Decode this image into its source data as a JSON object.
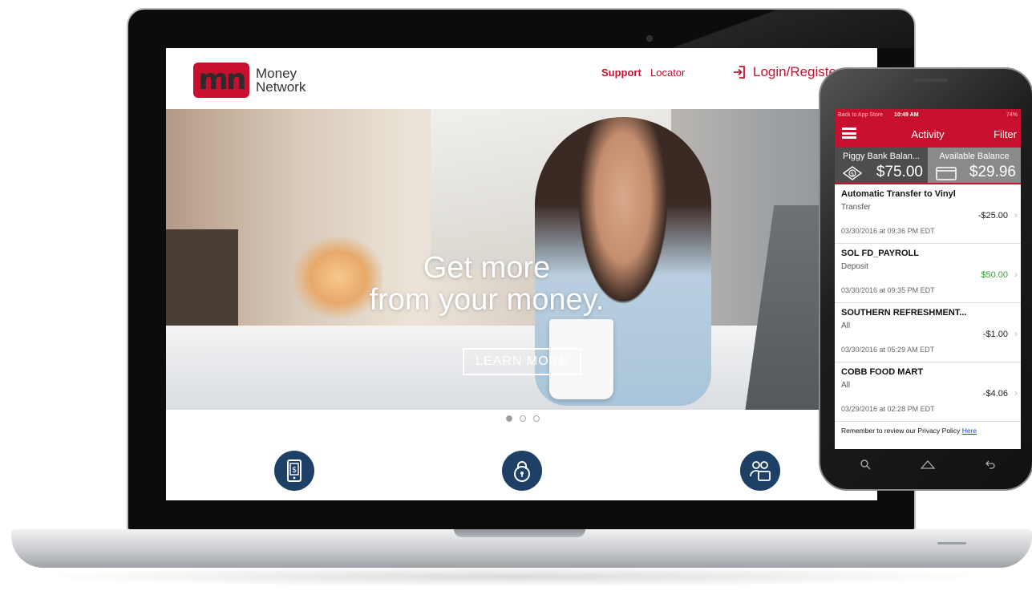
{
  "website": {
    "logo_mark": "mn",
    "brand_line1": "Money",
    "brand_line2": "Network",
    "nav": {
      "support": "Support",
      "locator": "Locator",
      "login": "Login/Register"
    },
    "hero": {
      "title_line1": "Get more",
      "title_line2": "from your money.",
      "cta": "LEARN MORE"
    },
    "carousel": {
      "slides": 3,
      "active": 1
    },
    "features": [
      "mobile-deposit-icon",
      "lock-icon",
      "people-icon"
    ],
    "colors": {
      "brand_red": "#c8102e",
      "feature_blue": "#1e3f66"
    }
  },
  "phone": {
    "status": {
      "back": "Back to App Store",
      "time": "10:49 AM",
      "battery": "74%"
    },
    "appbar": {
      "title": "Activity",
      "filter": "Filter"
    },
    "balances": {
      "piggy_label": "Piggy Bank Balan...",
      "piggy_amount": "$75.00",
      "available_label": "Available Balance",
      "available_amount": "$29.96"
    },
    "transactions": [
      {
        "name": "Automatic Transfer to Vinyl",
        "type": "Transfer",
        "amount": "-$25.00",
        "date": "03/30/2016 at 09:36 PM EDT"
      },
      {
        "name": "SOL FD_PAYROLL",
        "type": "Deposit",
        "amount": "$50.00",
        "date": "03/30/2016 at 09:35 PM EDT"
      },
      {
        "name": "SOUTHERN REFRESHMENT...",
        "type": "All",
        "amount": "-$1.00",
        "date": "03/30/2016 at 05:29 AM EDT"
      },
      {
        "name": "COBB FOOD MART",
        "type": "All",
        "amount": "-$4.06",
        "date": "03/29/2016 at 02:28 PM EDT"
      }
    ],
    "privacy": {
      "text": "Remember to review our Privacy Policy ",
      "link": "Here"
    }
  }
}
